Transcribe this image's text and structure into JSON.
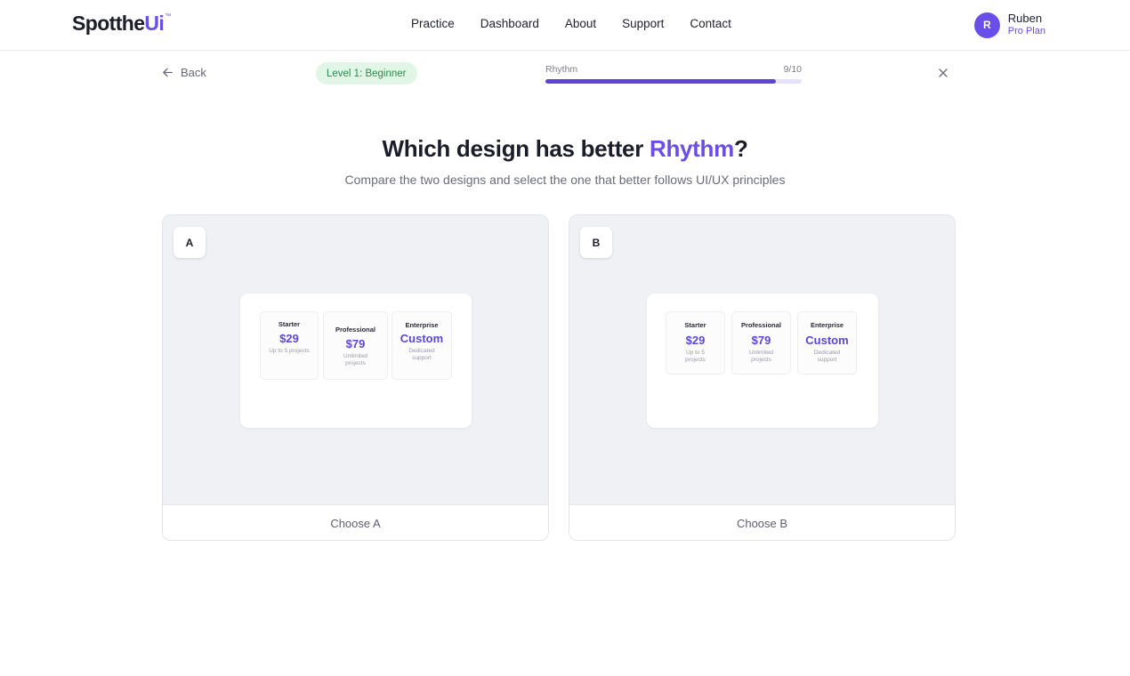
{
  "header": {
    "logo_main": "Spotthe",
    "logo_accent": "Ui",
    "logo_mark": "™",
    "nav": [
      "Practice",
      "Dashboard",
      "About",
      "Support",
      "Contact"
    ],
    "user": {
      "initial": "R",
      "name": "Ruben",
      "plan": "Pro Plan"
    }
  },
  "toolbar": {
    "back_label": "Back",
    "level": "Level 1: Beginner",
    "progress_label": "Rhythm",
    "progress_count": "9/10",
    "progress_value": 0.9
  },
  "question": {
    "prefix": "Which design has better ",
    "highlight": "Rhythm",
    "suffix": "?",
    "subtitle": "Compare the two designs and select the one that better follows UI/UX principles"
  },
  "options": [
    {
      "label": "A",
      "choose": "Choose A",
      "tiers": [
        {
          "name": "Starter",
          "price": "$29",
          "desc": "Up to 5 projects"
        },
        {
          "name": "Professional",
          "price": "$79",
          "desc": "Unlimited projects"
        },
        {
          "name": "Enterprise",
          "price": "Custom",
          "desc": "Dedicated support"
        }
      ]
    },
    {
      "label": "B",
      "choose": "Choose B",
      "tiers": [
        {
          "name": "Starter",
          "price": "$29",
          "desc": "Up to 5 projects"
        },
        {
          "name": "Professional",
          "price": "$79",
          "desc": "Unlimited projects"
        },
        {
          "name": "Enterprise",
          "price": "Custom",
          "desc": "Dedicated support"
        }
      ]
    }
  ],
  "colors": {
    "accent": "#6a4ee8",
    "progress_fill": "#5d43d6",
    "badge_bg": "#e2f6e7",
    "badge_text": "#2e8b4b"
  }
}
